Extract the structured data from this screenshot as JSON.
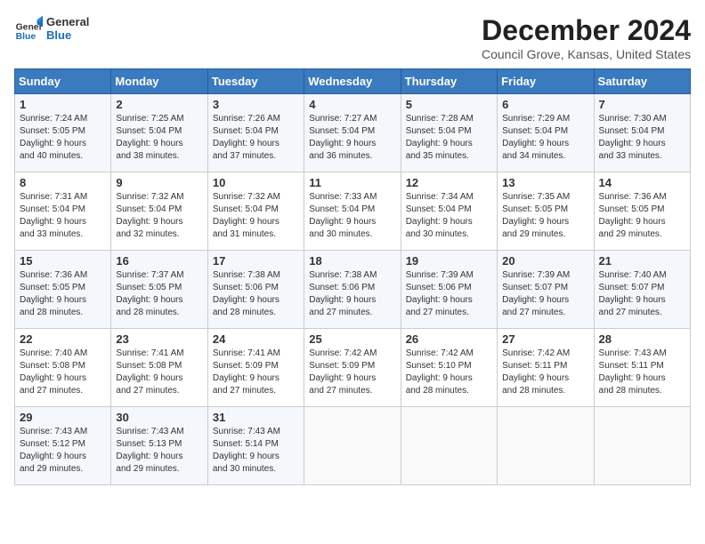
{
  "header": {
    "logo_general": "General",
    "logo_blue": "Blue",
    "title": "December 2024",
    "subtitle": "Council Grove, Kansas, United States"
  },
  "days_of_week": [
    "Sunday",
    "Monday",
    "Tuesday",
    "Wednesday",
    "Thursday",
    "Friday",
    "Saturday"
  ],
  "weeks": [
    [
      {
        "day": "1",
        "info": "Sunrise: 7:24 AM\nSunset: 5:05 PM\nDaylight: 9 hours\nand 40 minutes."
      },
      {
        "day": "2",
        "info": "Sunrise: 7:25 AM\nSunset: 5:04 PM\nDaylight: 9 hours\nand 38 minutes."
      },
      {
        "day": "3",
        "info": "Sunrise: 7:26 AM\nSunset: 5:04 PM\nDaylight: 9 hours\nand 37 minutes."
      },
      {
        "day": "4",
        "info": "Sunrise: 7:27 AM\nSunset: 5:04 PM\nDaylight: 9 hours\nand 36 minutes."
      },
      {
        "day": "5",
        "info": "Sunrise: 7:28 AM\nSunset: 5:04 PM\nDaylight: 9 hours\nand 35 minutes."
      },
      {
        "day": "6",
        "info": "Sunrise: 7:29 AM\nSunset: 5:04 PM\nDaylight: 9 hours\nand 34 minutes."
      },
      {
        "day": "7",
        "info": "Sunrise: 7:30 AM\nSunset: 5:04 PM\nDaylight: 9 hours\nand 33 minutes."
      }
    ],
    [
      {
        "day": "8",
        "info": "Sunrise: 7:31 AM\nSunset: 5:04 PM\nDaylight: 9 hours\nand 33 minutes."
      },
      {
        "day": "9",
        "info": "Sunrise: 7:32 AM\nSunset: 5:04 PM\nDaylight: 9 hours\nand 32 minutes."
      },
      {
        "day": "10",
        "info": "Sunrise: 7:32 AM\nSunset: 5:04 PM\nDaylight: 9 hours\nand 31 minutes."
      },
      {
        "day": "11",
        "info": "Sunrise: 7:33 AM\nSunset: 5:04 PM\nDaylight: 9 hours\nand 30 minutes."
      },
      {
        "day": "12",
        "info": "Sunrise: 7:34 AM\nSunset: 5:04 PM\nDaylight: 9 hours\nand 30 minutes."
      },
      {
        "day": "13",
        "info": "Sunrise: 7:35 AM\nSunset: 5:05 PM\nDaylight: 9 hours\nand 29 minutes."
      },
      {
        "day": "14",
        "info": "Sunrise: 7:36 AM\nSunset: 5:05 PM\nDaylight: 9 hours\nand 29 minutes."
      }
    ],
    [
      {
        "day": "15",
        "info": "Sunrise: 7:36 AM\nSunset: 5:05 PM\nDaylight: 9 hours\nand 28 minutes."
      },
      {
        "day": "16",
        "info": "Sunrise: 7:37 AM\nSunset: 5:05 PM\nDaylight: 9 hours\nand 28 minutes."
      },
      {
        "day": "17",
        "info": "Sunrise: 7:38 AM\nSunset: 5:06 PM\nDaylight: 9 hours\nand 28 minutes."
      },
      {
        "day": "18",
        "info": "Sunrise: 7:38 AM\nSunset: 5:06 PM\nDaylight: 9 hours\nand 27 minutes."
      },
      {
        "day": "19",
        "info": "Sunrise: 7:39 AM\nSunset: 5:06 PM\nDaylight: 9 hours\nand 27 minutes."
      },
      {
        "day": "20",
        "info": "Sunrise: 7:39 AM\nSunset: 5:07 PM\nDaylight: 9 hours\nand 27 minutes."
      },
      {
        "day": "21",
        "info": "Sunrise: 7:40 AM\nSunset: 5:07 PM\nDaylight: 9 hours\nand 27 minutes."
      }
    ],
    [
      {
        "day": "22",
        "info": "Sunrise: 7:40 AM\nSunset: 5:08 PM\nDaylight: 9 hours\nand 27 minutes."
      },
      {
        "day": "23",
        "info": "Sunrise: 7:41 AM\nSunset: 5:08 PM\nDaylight: 9 hours\nand 27 minutes."
      },
      {
        "day": "24",
        "info": "Sunrise: 7:41 AM\nSunset: 5:09 PM\nDaylight: 9 hours\nand 27 minutes."
      },
      {
        "day": "25",
        "info": "Sunrise: 7:42 AM\nSunset: 5:09 PM\nDaylight: 9 hours\nand 27 minutes."
      },
      {
        "day": "26",
        "info": "Sunrise: 7:42 AM\nSunset: 5:10 PM\nDaylight: 9 hours\nand 28 minutes."
      },
      {
        "day": "27",
        "info": "Sunrise: 7:42 AM\nSunset: 5:11 PM\nDaylight: 9 hours\nand 28 minutes."
      },
      {
        "day": "28",
        "info": "Sunrise: 7:43 AM\nSunset: 5:11 PM\nDaylight: 9 hours\nand 28 minutes."
      }
    ],
    [
      {
        "day": "29",
        "info": "Sunrise: 7:43 AM\nSunset: 5:12 PM\nDaylight: 9 hours\nand 29 minutes."
      },
      {
        "day": "30",
        "info": "Sunrise: 7:43 AM\nSunset: 5:13 PM\nDaylight: 9 hours\nand 29 minutes."
      },
      {
        "day": "31",
        "info": "Sunrise: 7:43 AM\nSunset: 5:14 PM\nDaylight: 9 hours\nand 30 minutes."
      },
      {
        "day": "",
        "info": ""
      },
      {
        "day": "",
        "info": ""
      },
      {
        "day": "",
        "info": ""
      },
      {
        "day": "",
        "info": ""
      }
    ]
  ]
}
